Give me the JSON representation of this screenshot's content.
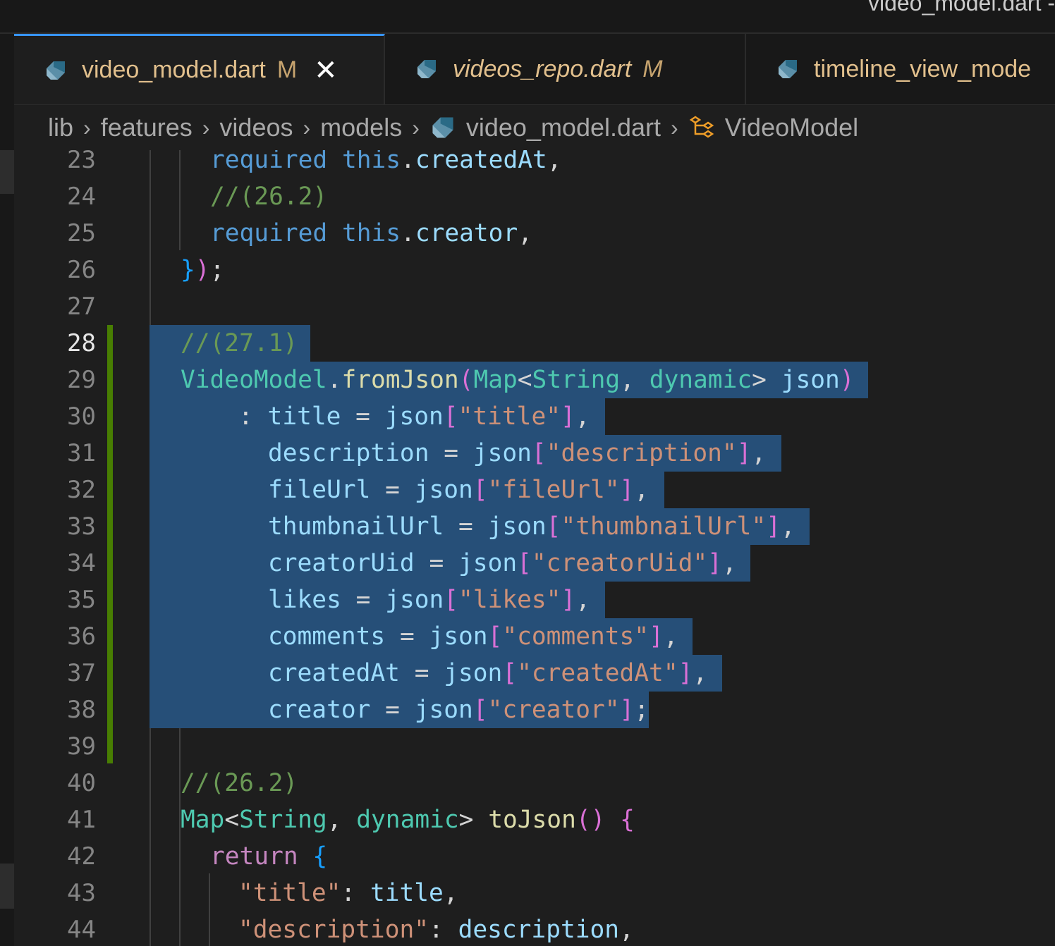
{
  "window": {
    "title": "video_model.dart -"
  },
  "tabs": [
    {
      "name": "video_model.dart",
      "status": "M",
      "close": "✕",
      "active": true
    },
    {
      "name": "videos_repo.dart",
      "status": "M",
      "active": false
    },
    {
      "name": "timeline_view_mode",
      "active": false
    }
  ],
  "breadcrumb": {
    "items": [
      "lib",
      "features",
      "videos",
      "models",
      "video_model.dart",
      "VideoModel"
    ],
    "separator": "›"
  },
  "editor": {
    "current_line": 28,
    "colors": {
      "selection": "#264f78",
      "modified_gutter": "#487e02",
      "keyword": "#569cd6",
      "type": "#4ec9b0",
      "string": "#ce9178",
      "comment": "#6a9955"
    },
    "lines": [
      {
        "num": "23",
        "text": "      required this.createdAt,"
      },
      {
        "num": "24",
        "text": "      //(26.2)"
      },
      {
        "num": "25",
        "text": "      required this.creator,"
      },
      {
        "num": "26",
        "text": "    });"
      },
      {
        "num": "27",
        "text": ""
      },
      {
        "num": "28",
        "text": "  //(27.1)"
      },
      {
        "num": "29",
        "text": "  VideoModel.fromJson(Map<String, dynamic> json)"
      },
      {
        "num": "30",
        "text": "      : title = json[\"title\"],"
      },
      {
        "num": "31",
        "text": "        description = json[\"description\"],"
      },
      {
        "num": "32",
        "text": "        fileUrl = json[\"fileUrl\"],"
      },
      {
        "num": "33",
        "text": "        thumbnailUrl = json[\"thumbnailUrl\"],"
      },
      {
        "num": "34",
        "text": "        creatorUid = json[\"creatorUid\"],"
      },
      {
        "num": "35",
        "text": "        likes = json[\"likes\"],"
      },
      {
        "num": "36",
        "text": "        comments = json[\"comments\"],"
      },
      {
        "num": "37",
        "text": "        createdAt = json[\"createdAt\"],"
      },
      {
        "num": "38",
        "text": "        creator = json[\"creator\"];"
      },
      {
        "num": "39",
        "text": ""
      },
      {
        "num": "40",
        "text": "  //(26.2)"
      },
      {
        "num": "41",
        "text": "  Map<String, dynamic> toJson() {"
      },
      {
        "num": "42",
        "text": "    return {"
      },
      {
        "num": "43",
        "text": "      \"title\": title,"
      },
      {
        "num": "44",
        "text": "      \"description\": description,"
      }
    ]
  }
}
